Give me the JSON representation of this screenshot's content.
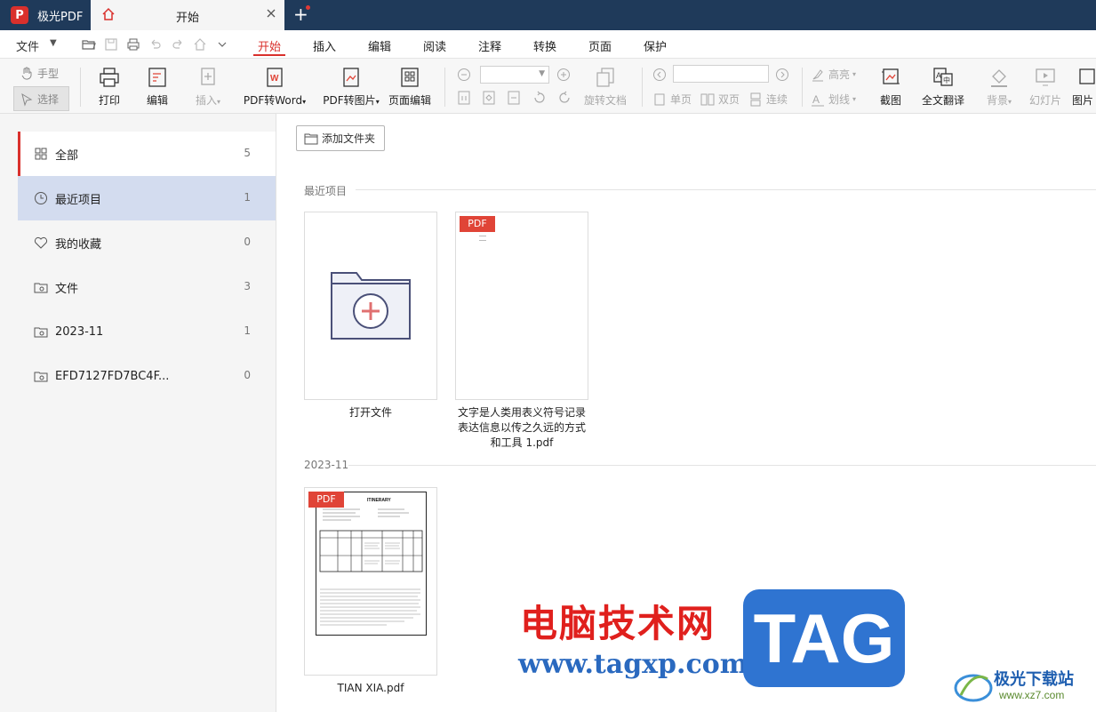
{
  "titlebar": {
    "app_name": "极光PDF",
    "app_logo_letter": "P",
    "tab_label": "开始",
    "new_tab_symbol": "+"
  },
  "menubar": {
    "file_label": "文件",
    "ribbon_tabs": [
      "开始",
      "插入",
      "编辑",
      "阅读",
      "注释",
      "转换",
      "页面",
      "保护"
    ],
    "active_tab": "开始"
  },
  "ribbon": {
    "hand_label": "手型",
    "select_label": "选择",
    "print_label": "打印",
    "edit_label": "编辑",
    "insert_label": "插入",
    "pdf_to_word_label": "PDF转Word",
    "pdf_to_image_label": "PDF转图片",
    "page_edit_label": "页面编辑",
    "rotate_doc_label": "旋转文档",
    "single_page_label": "单页",
    "double_page_label": "双页",
    "continuous_label": "连续",
    "highlight_label": "高亮",
    "strikeline_label": "划线",
    "screenshot_label": "截图",
    "full_translate_label": "全文翻译",
    "background_label": "背景",
    "slideshow_label": "幻灯片",
    "image_label": "图片"
  },
  "sidebar": {
    "items": [
      {
        "label": "全部",
        "count": "5",
        "icon": "grid-icon"
      },
      {
        "label": "最近项目",
        "count": "1",
        "icon": "clock-icon"
      },
      {
        "label": "我的收藏",
        "count": "0",
        "icon": "heart-icon"
      },
      {
        "label": "文件",
        "count": "3",
        "icon": "folder-icon"
      },
      {
        "label": "2023-11",
        "count": "1",
        "icon": "folder-icon"
      },
      {
        "label": "EFD7127FD7BC4F...",
        "count": "0",
        "icon": "folder-icon"
      }
    ]
  },
  "main": {
    "add_folder_label": "添加文件夹",
    "recent_section": "最近项目",
    "date_section": "2023-11",
    "open_file_label": "打开文件",
    "recent_file_caption_line1": "文字是人类用表义符号记录",
    "recent_file_caption_line2": "表达信息以传之久远的方式",
    "recent_file_caption_line3": "和工具 1.pdf",
    "pdf_badge": "PDF",
    "date_file_caption": "TIAN XIA.pdf",
    "itinerary_title": "ITINERARY"
  },
  "watermark": {
    "cn_text": "电脑技术网",
    "url_text": "www.tagxp.com",
    "tag_text": "TAG",
    "site_name": "极光下载站",
    "site_url": "www.xz7.com"
  },
  "colors": {
    "titlebar_bg": "#1f3a5a",
    "accent_red": "#d9302c",
    "selected_bg": "#d3dcef",
    "pdf_badge_bg": "#e04437",
    "watermark_blue": "#2f74d1"
  }
}
